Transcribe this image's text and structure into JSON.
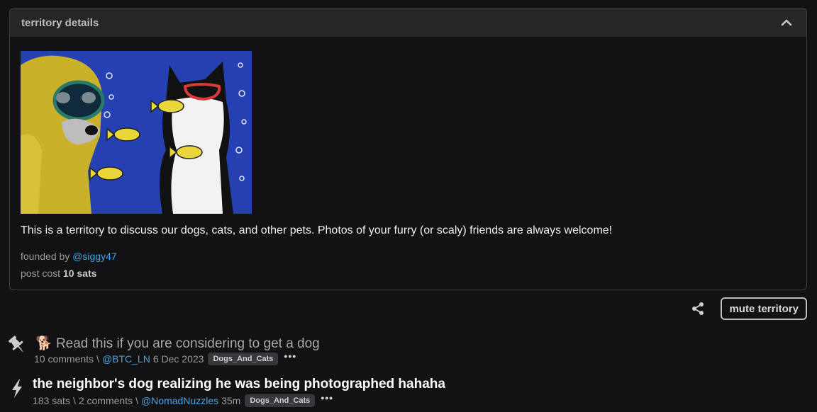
{
  "panel": {
    "title": "territory details",
    "toggle_icon": "chevron-up-icon",
    "description": "This is a territory to discuss our dogs, cats, and other pets. Photos of your furry (or scaly) friends are always welcome!",
    "founded_label": "founded by",
    "founder": "@siggy47",
    "post_cost_label": "post cost",
    "post_cost_value": "10 sats"
  },
  "actions": {
    "share_icon": "share-icon",
    "mute_label": "mute territory"
  },
  "items": [
    {
      "icon": "pin-icon",
      "emoji": "🐕",
      "title": "Read this if you are considering to get a dog",
      "comments": "10 comments",
      "sep": "\\",
      "author": "@BTC_LN",
      "time": "6 Dec 2023",
      "badge": "Dogs_And_Cats",
      "more": "•••"
    },
    {
      "icon": "lightning-icon",
      "title": "the neighbor's dog realizing he was being photographed hahaha",
      "sats": "183 sats",
      "sep": "\\",
      "comments": "2 comments",
      "sep2": "\\",
      "author": "@NomadNuzzles",
      "time": "35m",
      "badge": "Dogs_And_Cats",
      "more": "•••"
    }
  ],
  "colors": {
    "background": "#121214",
    "header": "#262628",
    "link": "#4aa3df",
    "border": "#3c3c40"
  }
}
